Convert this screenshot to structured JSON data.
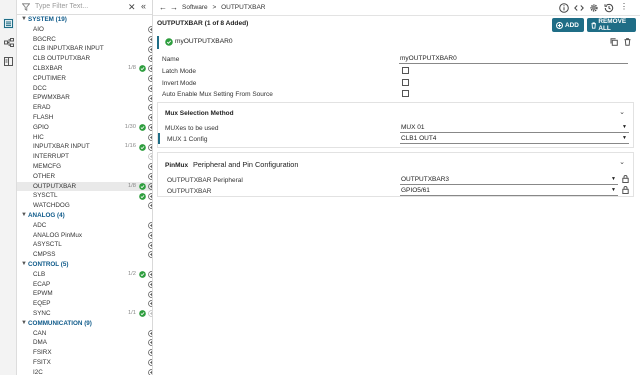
{
  "filter": {
    "placeholder": "Type Filter Text..."
  },
  "tree": [
    {
      "type": "cat",
      "label": "SYSTEM (19)"
    },
    {
      "type": "mod",
      "label": "AIO"
    },
    {
      "type": "mod",
      "label": "BGCRC"
    },
    {
      "type": "mod",
      "label": "CLB INPUTXBAR INPUT"
    },
    {
      "type": "mod",
      "label": "CLB OUTPUTXBAR"
    },
    {
      "type": "mod",
      "label": "CLBXBAR",
      "count": "1/8",
      "ok": true
    },
    {
      "type": "mod",
      "label": "CPUTIMER"
    },
    {
      "type": "mod",
      "label": "DCC"
    },
    {
      "type": "mod",
      "label": "EPWMXBAR"
    },
    {
      "type": "mod",
      "label": "ERAD"
    },
    {
      "type": "mod",
      "label": "FLASH"
    },
    {
      "type": "mod",
      "label": "GPIO",
      "count": "1/30",
      "ok": true
    },
    {
      "type": "mod",
      "label": "HIC"
    },
    {
      "type": "mod",
      "label": "INPUTXBAR INPUT",
      "count": "1/16",
      "ok": true
    },
    {
      "type": "mod",
      "label": "INTERRUPT",
      "disabled": true
    },
    {
      "type": "mod",
      "label": "MEMCFG"
    },
    {
      "type": "mod",
      "label": "OTHER"
    },
    {
      "type": "mod",
      "label": "OUTPUTXBAR",
      "count": "1/8",
      "ok": true,
      "selected": true
    },
    {
      "type": "mod",
      "label": "SYSCTL",
      "ok": true
    },
    {
      "type": "mod",
      "label": "WATCHDOG"
    },
    {
      "type": "cat",
      "label": "ANALOG (4)"
    },
    {
      "type": "mod",
      "label": "ADC"
    },
    {
      "type": "mod",
      "label": "ANALOG PinMux"
    },
    {
      "type": "mod",
      "label": "ASYSCTL"
    },
    {
      "type": "mod",
      "label": "CMPSS"
    },
    {
      "type": "cat",
      "label": "CONTROL (5)"
    },
    {
      "type": "mod",
      "label": "CLB",
      "count": "1/2",
      "ok": true
    },
    {
      "type": "mod",
      "label": "ECAP"
    },
    {
      "type": "mod",
      "label": "EPWM"
    },
    {
      "type": "mod",
      "label": "EQEP"
    },
    {
      "type": "mod",
      "label": "SYNC",
      "count": "1/1",
      "ok": true,
      "disabled": true
    },
    {
      "type": "cat",
      "label": "COMMUNICATION (9)"
    },
    {
      "type": "mod",
      "label": "CAN"
    },
    {
      "type": "mod",
      "label": "DMA"
    },
    {
      "type": "mod",
      "label": "FSIRX"
    },
    {
      "type": "mod",
      "label": "FSITX"
    },
    {
      "type": "mod",
      "label": "I2C"
    }
  ],
  "breadcrumb": {
    "root": "Software",
    "sep": ">",
    "current": "OUTPUTXBAR"
  },
  "header": {
    "title": "OUTPUTXBAR (1 of 8 Added)",
    "add_label": "ADD",
    "remove_label": "REMOVE ALL"
  },
  "instance": {
    "name": "myOUTPUTXBAR0"
  },
  "props": {
    "name_label": "Name",
    "name_value": "myOUTPUTXBAR0",
    "latch_label": "Latch Mode",
    "invert_label": "Invert Mode",
    "auto_label": "Auto Enable Mux Setting From Source"
  },
  "mux": {
    "title": "Mux Selection Method",
    "muxes_label": "MUXes to be used",
    "muxes_value": "MUX 01",
    "config_label": "MUX 1 Config",
    "config_value": "CLB1 OUT4"
  },
  "pinmux": {
    "title_bold": "PinMux",
    "title_rest": "Peripheral and Pin Configuration",
    "periph_label": "OUTPUTXBAR Peripheral",
    "periph_value": "OUTPUTXBAR3",
    "pin_label": "OUTPUTXBAR",
    "pin_value": "GPIO5/61"
  },
  "colors": {
    "accent": "#1f6d86",
    "ok": "#2e9e3e",
    "category": "#0e5a8a"
  }
}
